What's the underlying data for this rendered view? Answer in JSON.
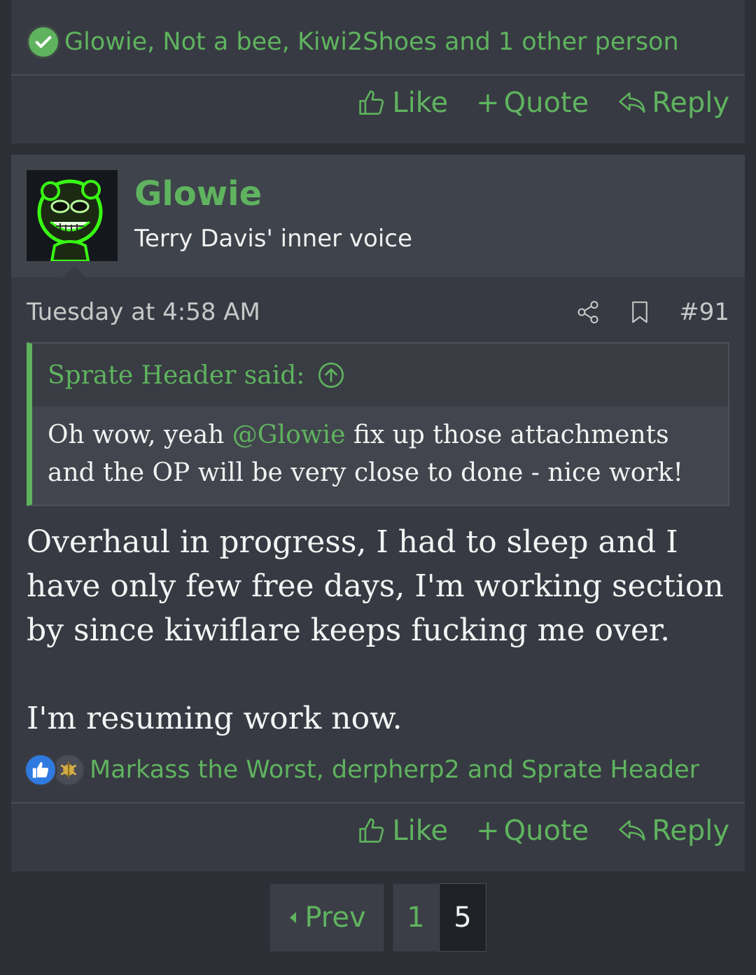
{
  "previous_post": {
    "reactions_text": "Glowie, Not a bee, Kiwi2Shoes and 1 other person",
    "actions": {
      "like": "Like",
      "quote": "Quote",
      "reply": "Reply"
    }
  },
  "post": {
    "username": "Glowie",
    "user_title": "Terry Davis' inner voice",
    "date": "Tuesday at 4:58 AM",
    "post_number": "#91",
    "quote": {
      "attribution": "Sprate Header said:",
      "before_mention": "Oh wow, yeah ",
      "mention": "@Glowie",
      "after_mention": " fix up those attachments and the OP will be very close to done - nice work!"
    },
    "body": [
      "Overhaul in progress, I had to sleep and I have only few free days, I'm working section by since kiwiflare keeps fucking me over.",
      "I'm resuming work now."
    ],
    "reactions_text": "Markass the Worst, derpherp2 and Sprate Header",
    "actions": {
      "like": "Like",
      "quote": "Quote",
      "reply": "Reply"
    }
  },
  "pagination": {
    "prev_label": "Prev",
    "pages": [
      "1",
      "5"
    ],
    "current": "5"
  },
  "colors": {
    "accent": "#5fb35f",
    "background": "#2c2f36",
    "card": "#373a42"
  }
}
